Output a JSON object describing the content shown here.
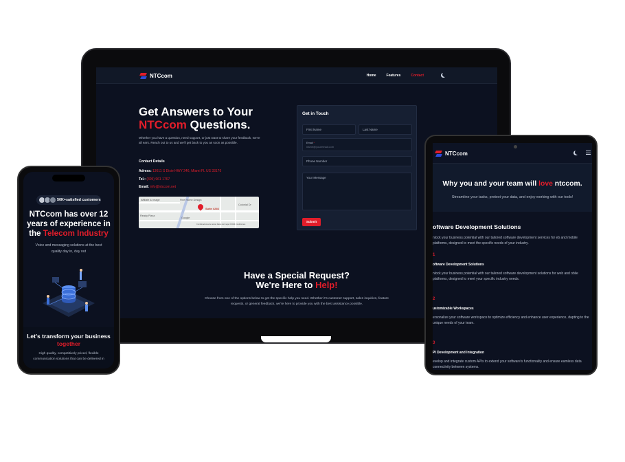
{
  "brand": {
    "name": "NTCcom",
    "accent": "#e11d2a",
    "bg": "#0c1120"
  },
  "laptop": {
    "nav": {
      "links": [
        "Home",
        "Features",
        "Contact"
      ],
      "active": "Contact",
      "theme_icon": "moon-icon"
    },
    "hero": {
      "title_line1": "Get Answers to Your",
      "title_brand": "NTCcom",
      "title_rest": " Questions.",
      "lead": "Whether you have a question, need support, or just want to share your feedback, we're all ears. Reach out to us and we'll get back to you as soon as possible."
    },
    "contact_details": {
      "heading": "Contact Details",
      "address_label": "Adress:",
      "address": "13611 S Dixie HWY 246, Miami FL US 33176",
      "tel_label": "Tel.:",
      "tel": "(305) 961 1767",
      "email_label": "Email:",
      "email": "info@ntccom.net"
    },
    "map": {
      "labels": [
        "Affiliate & Image",
        "Fine Home Design",
        "Suite #246",
        "Ready Pizza",
        "Colonial Dr",
        "Google",
        "Combinaciones de teclas  Datos del mapa ©2024  Condiciones"
      ]
    },
    "form": {
      "title": "Get in Touch",
      "first_name": "First Name",
      "last_name": "Last Name",
      "email_label": "Email",
      "email_placeholder": "name@youremail.com",
      "phone": "Phone Number",
      "message": "Your Message",
      "submit": "Submit"
    },
    "special": {
      "line1": "Have a Special Request?",
      "line2_pre": "We're Here to ",
      "line2_red": "Help!",
      "text": "Choose from one of the options below to get the specific help you need. Whether it's customer support, sales inquiries, feature requests, or general feedback, we're here to provide you with the best assistance possible."
    }
  },
  "phone": {
    "badge": "50K+satisfied customers",
    "title_pre": "NTCcom has over 12 years of experience in the ",
    "title_red": "Telecom Industry",
    "subtitle": "Voice and messaging solutions at the best quality day in, day out",
    "section_title_pre": "Let's transform your business ",
    "section_title_red": "together",
    "section_text": "High quality, competitively priced, flexible communication solutions that can be delivered in"
  },
  "tablet": {
    "hero_title_pre": "Why you and your team will ",
    "hero_title_red": "love",
    "hero_title_post": " ntccom.",
    "hero_sub": "Streamline your tasks, protect your data, and enjoy working with our tools!",
    "section_title": "oftware Development Solutions",
    "section_text": "nlock your business potential with our tailored software development services for eb and mobile platforms, designed to meet the specific needs of your industry.",
    "items": [
      {
        "num": "1",
        "title": "oftware Development Solutions",
        "text": "nlock your business potential with our tailored software development solutions for web and obile platforms, designed to meet your specific industry needs."
      },
      {
        "num": "2",
        "title": "ustomizable Workspaces",
        "text": "ersonalize your software workspace to optimize efficiency and enhance user experience, dapting to the unique needs of your team."
      },
      {
        "num": "3",
        "title": "PI Development and Integration",
        "text": "evelop and integrate custom APIs to extend your software's functionality and ensure eamless data connectivity between systems."
      }
    ]
  }
}
